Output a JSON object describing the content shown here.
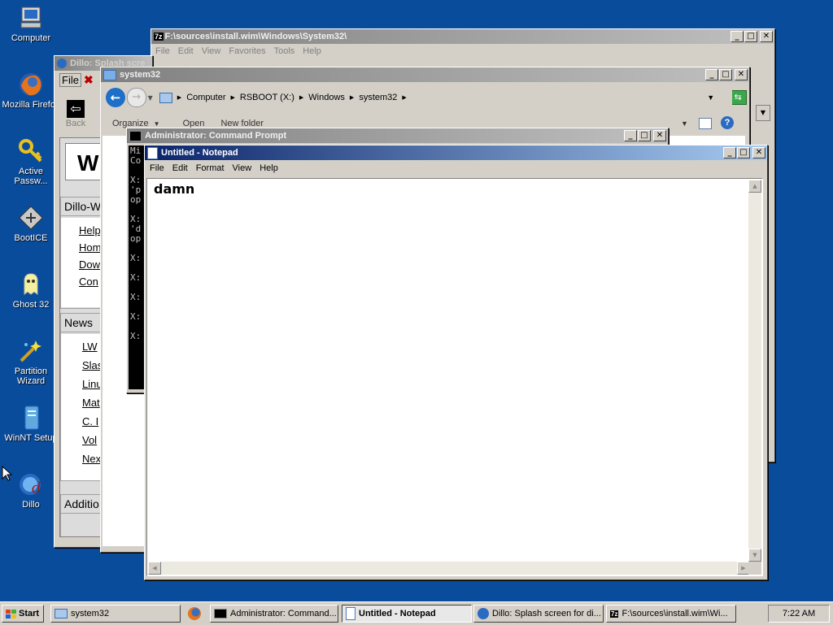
{
  "desktop": {
    "icons": [
      {
        "label": "Computer"
      },
      {
        "label": "Mozilla Firefox"
      },
      {
        "label": "Active\nPassw..."
      },
      {
        "label": "BootICE"
      },
      {
        "label": "Ghost 32"
      },
      {
        "label": "Partition\nWizard"
      },
      {
        "label": "WinNT Setup"
      },
      {
        "label": "Dillo"
      }
    ]
  },
  "win7z": {
    "title": "F:\\sources\\install.wim\\Windows\\System32\\",
    "menu": [
      "File",
      "Edit",
      "View",
      "Favorites",
      "Tools",
      "Help"
    ]
  },
  "dillo": {
    "title": "Dillo: Splash scre",
    "menu_file": "File",
    "back_label": "Back",
    "heading": "W",
    "section1": "Dillo-W",
    "links1": [
      "Help",
      "Hom",
      "Dow",
      "Con"
    ],
    "section2": "News",
    "links2": [
      "LW",
      "Slas",
      "Linu",
      "Mat",
      "C. I",
      "Vol",
      "Nex"
    ],
    "section3": "Additio"
  },
  "explorer": {
    "title": "system32",
    "breadcrumb": [
      "Computer",
      "RSBOOT (X:)",
      "Windows",
      "system32"
    ],
    "toolbar": {
      "organize": "Organize",
      "open": "Open",
      "new_folder": "New folder"
    }
  },
  "cmd": {
    "title": "Administrator: Command Prompt",
    "lines": [
      "Mi",
      "Co",
      "",
      "X:",
      "'p",
      "op",
      "",
      "X:",
      "'d",
      "op",
      "",
      "X:",
      "",
      "X:",
      "",
      "X:",
      "",
      "X:",
      "",
      "X:"
    ]
  },
  "notepad": {
    "title": "Untitled - Notepad",
    "menu": [
      "File",
      "Edit",
      "Format",
      "View",
      "Help"
    ],
    "content": "damn"
  },
  "taskbar": {
    "start": "Start",
    "buttons": [
      {
        "label": "system32"
      },
      {
        "label": "Administrator: Command..."
      },
      {
        "label": "Untitled - Notepad"
      },
      {
        "label": "Dillo: Splash screen for di..."
      },
      {
        "label": "F:\\sources\\install.wim\\Wi..."
      }
    ],
    "clock": "7:22 AM"
  }
}
